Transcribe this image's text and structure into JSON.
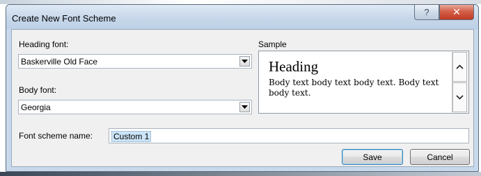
{
  "dialog": {
    "title": "Create New Font Scheme",
    "help_glyph": "?",
    "close_glyph": "✕"
  },
  "heading_font": {
    "label": "Heading font:",
    "value": "Baskerville Old Face"
  },
  "body_font": {
    "label": "Body font:",
    "value": "Georgia"
  },
  "sample": {
    "label": "Sample",
    "heading_text": "Heading",
    "body_text": "Body text body text body text. Body text body text."
  },
  "scheme_name": {
    "label": "Font scheme name:",
    "value": "Custom 1"
  },
  "buttons": {
    "save": "Save",
    "cancel": "Cancel"
  },
  "colors": {
    "close_button": "#c23a22",
    "selection_highlight": "#cce4f7",
    "default_button_border": "#3c7fb1"
  }
}
